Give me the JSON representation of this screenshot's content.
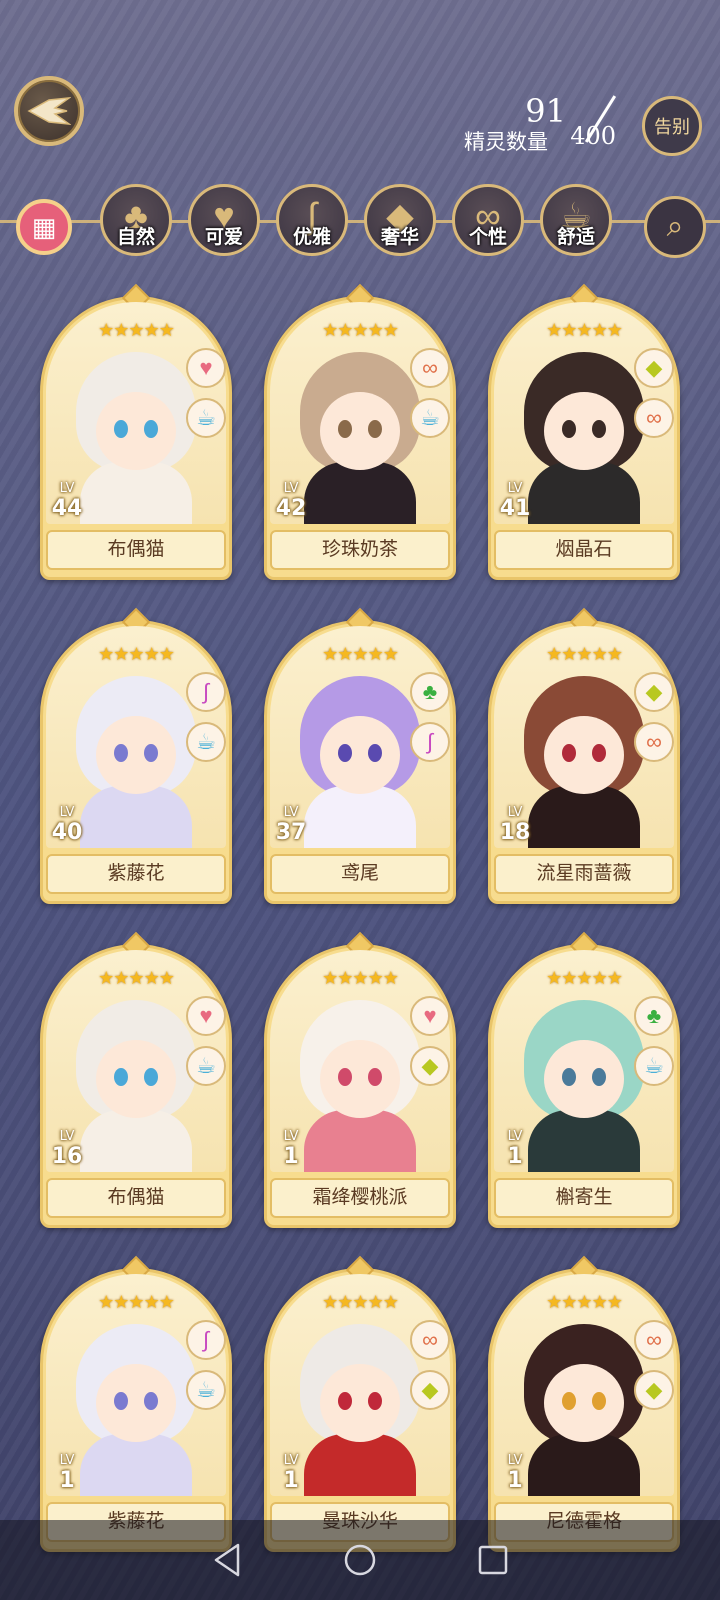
{
  "spirit_count": {
    "label": "精灵数量",
    "current": "91",
    "max": "400"
  },
  "farewell_button": "告别",
  "filters": [
    {
      "label": "自然",
      "icon": "clover-icon",
      "glyph": "♣"
    },
    {
      "label": "可爱",
      "icon": "heart-icon",
      "glyph": "♥"
    },
    {
      "label": "优雅",
      "icon": "swan-icon",
      "glyph": "∫"
    },
    {
      "label": "奢华",
      "icon": "diamond-icon",
      "glyph": "◆"
    },
    {
      "label": "个性",
      "icon": "glasses-icon",
      "glyph": "∞"
    },
    {
      "label": "舒适",
      "icon": "teacup-icon",
      "glyph": "☕"
    }
  ],
  "cards": [
    {
      "name": "布偶猫",
      "level_label": "LV",
      "level": "44",
      "stars": "★★★★★",
      "badges": [
        "heart-icon",
        "teacup-icon"
      ],
      "hair": "#f1ece6",
      "eyes": "#4aa8d8",
      "outfit": "#f6efe6"
    },
    {
      "name": "珍珠奶茶",
      "level_label": "LV",
      "level": "42",
      "stars": "★★★★★",
      "badges": [
        "glasses-icon",
        "teacup-icon"
      ],
      "hair": "#c9ab8f",
      "eyes": "#8a6a4a",
      "outfit": "#2a2026"
    },
    {
      "name": "烟晶石",
      "level_label": "LV",
      "level": "41",
      "stars": "★★★★★",
      "badges": [
        "diamond-icon",
        "glasses-icon"
      ],
      "hair": "#3a2a26",
      "eyes": "#3a2a26",
      "outfit": "#2c2a2a"
    },
    {
      "name": "紫藤花",
      "level_label": "LV",
      "level": "40",
      "stars": "★★★★★",
      "badges": [
        "swan-icon",
        "teacup-icon"
      ],
      "hair": "#ecebf5",
      "eyes": "#7a7ad0",
      "outfit": "#dcd8f2"
    },
    {
      "name": "鸢尾",
      "level_label": "LV",
      "level": "37",
      "stars": "★★★★★",
      "badges": [
        "clover-icon",
        "swan-icon"
      ],
      "hair": "#b59ae6",
      "eyes": "#5a4ab0",
      "outfit": "#f4f0fb"
    },
    {
      "name": "流星雨蔷薇",
      "level_label": "LV",
      "level": "18",
      "stars": "★★★★★",
      "badges": [
        "diamond-icon",
        "glasses-icon"
      ],
      "hair": "#8a4a36",
      "eyes": "#b02a3a",
      "outfit": "#2a1a1a"
    },
    {
      "name": "布偶猫",
      "level_label": "LV",
      "level": "16",
      "stars": "★★★★★",
      "badges": [
        "heart-icon",
        "teacup-icon"
      ],
      "hair": "#f1ece6",
      "eyes": "#4aa8d8",
      "outfit": "#f6efe6"
    },
    {
      "name": "霜绛樱桃派",
      "level_label": "LV",
      "level": "1",
      "stars": "★★★★★",
      "badges": [
        "heart-icon",
        "diamond-icon"
      ],
      "hair": "#f7f1ea",
      "eyes": "#d04a6a",
      "outfit": "#e88090"
    },
    {
      "name": "槲寄生",
      "level_label": "LV",
      "level": "1",
      "stars": "★★★★★",
      "badges": [
        "clover-icon",
        "teacup-icon"
      ],
      "hair": "#9ad6c6",
      "eyes": "#4a7a9a",
      "outfit": "#2a3a3a"
    },
    {
      "name": "紫藤花",
      "level_label": "LV",
      "level": "1",
      "stars": "★★★★★",
      "badges": [
        "swan-icon",
        "teacup-icon"
      ],
      "hair": "#ecebf5",
      "eyes": "#7a7ad0",
      "outfit": "#dcd8f2"
    },
    {
      "name": "曼珠沙华",
      "level_label": "LV",
      "level": "1",
      "stars": "★★★★★",
      "badges": [
        "glasses-icon",
        "diamond-icon"
      ],
      "hair": "#eeeae6",
      "eyes": "#c0283a",
      "outfit": "#c42a2a"
    },
    {
      "name": "尼德霍格",
      "level_label": "LV",
      "level": "1",
      "stars": "★★★★★",
      "badges": [
        "glasses-icon",
        "diamond-icon"
      ],
      "hair": "#3a2220",
      "eyes": "#e0a030",
      "outfit": "#2a1a1a"
    }
  ],
  "badge_glyphs": {
    "heart-icon": {
      "glyph": "♥",
      "color": "#e86a80"
    },
    "teacup-icon": {
      "glyph": "☕",
      "color": "#4ab0d8"
    },
    "glasses-icon": {
      "glyph": "∞",
      "color": "#e0704a"
    },
    "diamond-icon": {
      "glyph": "◆",
      "color": "#b8c820"
    },
    "swan-icon": {
      "glyph": "∫",
      "color": "#c84ac0"
    },
    "clover-icon": {
      "glyph": "♣",
      "color": "#3ab040"
    }
  }
}
